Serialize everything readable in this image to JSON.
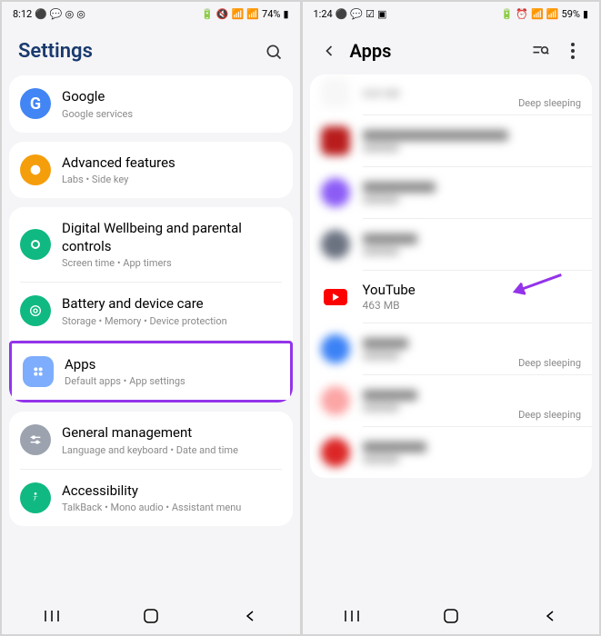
{
  "left": {
    "statusbar": {
      "time": "8:12",
      "battery": "74%"
    },
    "header": {
      "title": "Settings"
    },
    "items": [
      {
        "title": "Google",
        "sub": "Google services",
        "iconBg": "#4285f4",
        "iconFg": "#fff",
        "iconLetter": "G"
      },
      {
        "title": "Advanced features",
        "sub": "Labs  •  Side key",
        "iconBg": "#f59e0b"
      },
      {
        "title": "Digital Wellbeing and parental controls",
        "sub": "Screen time  •  App timers",
        "iconBg": "#10b981"
      },
      {
        "title": "Battery and device care",
        "sub": "Storage  •  Memory  •  Device protection",
        "iconBg": "#10b981"
      },
      {
        "title": "Apps",
        "sub": "Default apps  •  App settings",
        "iconBg": "#7dadfc",
        "highlighted": true
      },
      {
        "title": "General management",
        "sub": "Language and keyboard  •  Date and time",
        "iconBg": "#9ca3af"
      },
      {
        "title": "Accessibility",
        "sub": "TalkBack  •  Mono audio  •  Assistant menu",
        "iconBg": "#10b981"
      }
    ]
  },
  "right": {
    "statusbar": {
      "time": "1:24",
      "battery": "59%"
    },
    "header": {
      "title": "Apps"
    },
    "topSize": "608 MB",
    "topStatus": "Deep sleeping",
    "apps": [
      {
        "name": "Blurred",
        "size": "xxx",
        "iconBg": "#b91c1c",
        "blurred": true
      },
      {
        "name": "Blurred",
        "size": "xxx",
        "iconBg": "#8b5cf6",
        "blurred": true
      },
      {
        "name": "Blurred",
        "size": "xxx",
        "iconBg": "#6b7280",
        "blurred": true
      },
      {
        "name": "YouTube",
        "size": "463 MB",
        "iconBg": "#fff",
        "clear": true
      },
      {
        "name": "Blurred",
        "size": "xxx",
        "iconBg": "#3b82f6",
        "blurred": true,
        "status": "Deep sleeping"
      },
      {
        "name": "Blurred",
        "size": "xxx",
        "iconBg": "#fca5a5",
        "blurred": true,
        "status": "Deep sleeping"
      },
      {
        "name": "Blurred",
        "size": "xxx",
        "iconBg": "#dc2626",
        "blurred": true
      }
    ]
  }
}
